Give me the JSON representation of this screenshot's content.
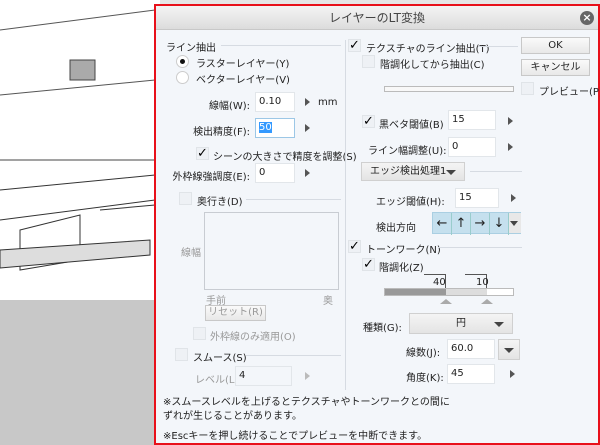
{
  "dialog": {
    "title": "レイヤーのLT変換",
    "close_icon": "close-icon"
  },
  "line_extraction": {
    "label": "ライン抽出",
    "raster": "ラスターレイヤー(Y)",
    "vector": "ベクターレイヤー(V)",
    "width_label": "線幅(W):",
    "width_value": "0.10",
    "width_unit": "mm",
    "precision_label": "検出精度(F):",
    "precision_value": "50",
    "scene_adjust": "シーンの大きさで精度を調整(S)",
    "outline_label": "外枠線強調度(E):",
    "outline_value": "0"
  },
  "depth": {
    "label": "奥行き(D)",
    "graph_ylabel": "線幅",
    "near": "手前",
    "far": "奥",
    "reset": "リセット(R)",
    "outline_only": "外枠線のみ適用(O)"
  },
  "smooth": {
    "label": "スムース(S)",
    "level_label": "レベル(L):",
    "level_value": "4"
  },
  "texture": {
    "label": "テクスチャのライン抽出(T)",
    "posterize_first": "階調化してから抽出(C)",
    "black_label": "黒ベタ閾値(B)",
    "black_value": "15",
    "linewidth_label": "ライン幅調整(U):",
    "linewidth_value": "0",
    "edge_mode": "エッジ検出処理1",
    "edge_label": "エッジ閾値(H):",
    "edge_value": "15",
    "direction_label": "検出方向",
    "directions": [
      "←",
      "↑",
      "→",
      "↓"
    ]
  },
  "tone": {
    "label": "トーンワーク(N)",
    "posterize": "階調化(Z)",
    "level1": "40",
    "level2": "10",
    "type_label": "種類(G):",
    "type_value": "円",
    "lines_label": "線数(J):",
    "lines_value": "60.0",
    "angle_label": "角度(K):",
    "angle_value": "45"
  },
  "buttons": {
    "ok": "OK",
    "cancel": "キャンセル",
    "preview": "プレビュー(P)"
  },
  "notes": [
    "※スムースレベルを上げるとテクスチャやトーンワークとの間に",
    "ずれが生じることがあります。",
    "※Escキーを押し続けることでプレビューを中断できます。"
  ],
  "colors": {
    "accent": "#e8101a",
    "dir_bg": "#c5e0ee"
  }
}
